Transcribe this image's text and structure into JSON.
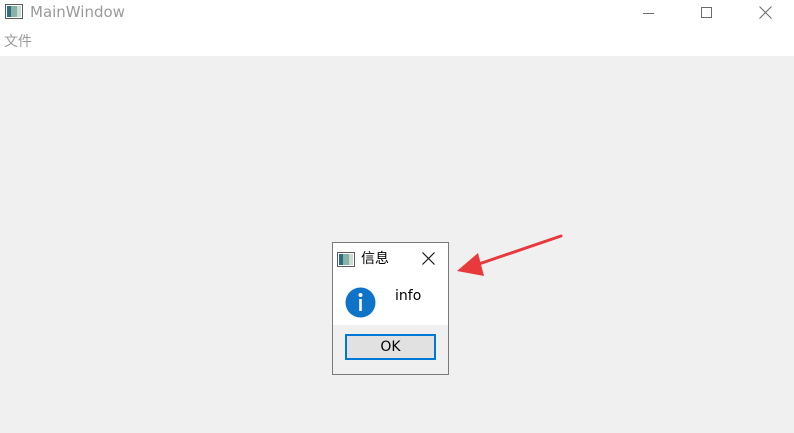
{
  "window": {
    "title": "MainWindow",
    "icon": "app-window-icon",
    "controls": [
      "minimize-icon",
      "maximize-icon",
      "close-icon"
    ]
  },
  "menubar": {
    "items": [
      {
        "label": "文件"
      }
    ]
  },
  "dialog": {
    "title": "信息",
    "icon": "app-window-icon",
    "message_icon": "info-icon",
    "message": "info",
    "ok_label": "OK"
  },
  "annotation": {
    "type": "arrow",
    "color": "#e8393d"
  },
  "colors": {
    "client_background": "#f0f0f0",
    "info_icon": "#0f73c8",
    "focus_border": "#0078d7",
    "button_face": "#e1e1e1"
  }
}
